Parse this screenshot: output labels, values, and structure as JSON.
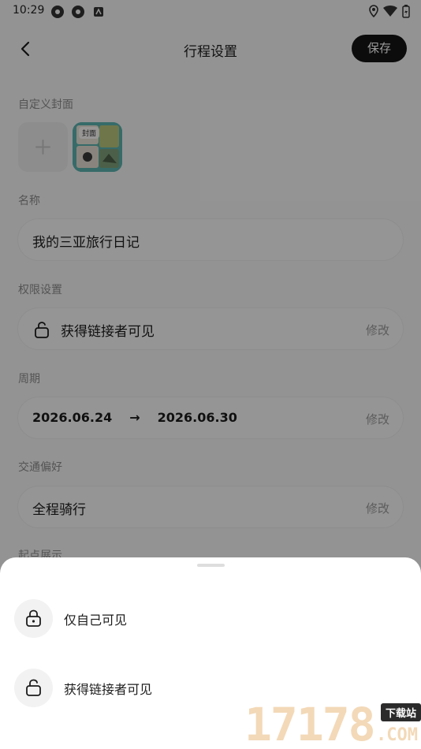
{
  "status_bar": {
    "time": "10:29"
  },
  "header": {
    "title": "行程设置",
    "save_label": "保存"
  },
  "form": {
    "cover": {
      "label": "自定义封面",
      "thumb_badge": "封面"
    },
    "name": {
      "label": "名称",
      "value": "我的三亚旅行日记"
    },
    "permission": {
      "label": "权限设置",
      "value": "获得链接者可见",
      "action": "修改"
    },
    "period": {
      "label": "周期",
      "start": "2026.06.24",
      "arrow": "→",
      "end": "2026.06.30",
      "action": "修改"
    },
    "transport": {
      "label": "交通偏好",
      "value": "全程骑行",
      "action": "修改"
    },
    "start_display": {
      "label": "起点展示"
    }
  },
  "sheet": {
    "options": [
      {
        "label": "仅自己可见",
        "icon": "lock-icon"
      },
      {
        "label": "获得链接者可见",
        "icon": "unlock-icon"
      }
    ]
  },
  "watermark": {
    "number": "17178",
    "badge": "下载站",
    "domain": ".COM"
  }
}
